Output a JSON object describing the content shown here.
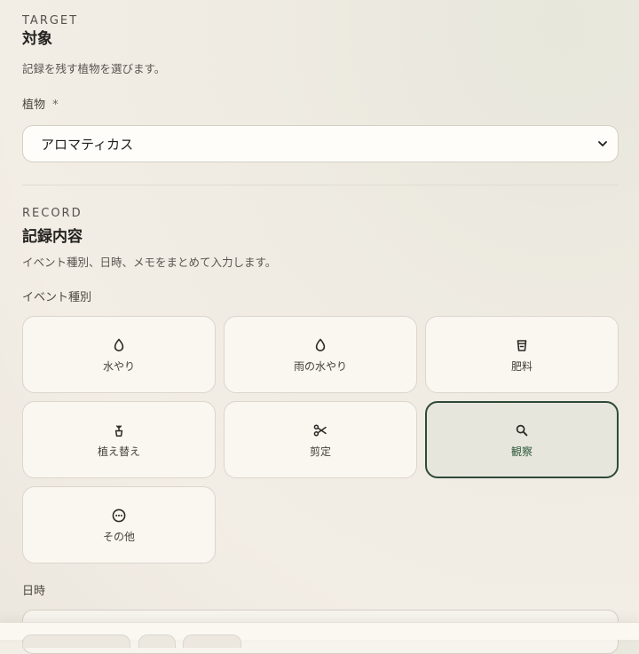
{
  "target_section": {
    "eyebrow": "TARGET",
    "title": "対象",
    "description": "記録を残す植物を選びます。",
    "plant_label": "植物",
    "required_mark": "*",
    "plant_selected": "アロマティカス"
  },
  "record_section": {
    "eyebrow": "RECORD",
    "title": "記録内容",
    "description": "イベント種別、日時、メモをまとめて入力します。",
    "event_type_label": "イベント種別",
    "event_types": [
      {
        "label": "水やり",
        "icon": "water-drop-icon",
        "selected": false
      },
      {
        "label": "雨の水やり",
        "icon": "water-drop-icon",
        "selected": false
      },
      {
        "label": "肥料",
        "icon": "fertilizer-bag-icon",
        "selected": false
      },
      {
        "label": "植え替え",
        "icon": "potted-plant-icon",
        "selected": false
      },
      {
        "label": "剪定",
        "icon": "scissors-icon",
        "selected": false
      },
      {
        "label": "観察",
        "icon": "search-icon",
        "selected": true
      },
      {
        "label": "その他",
        "icon": "more-circle-icon",
        "selected": false
      }
    ],
    "datetime_label": "日時"
  },
  "colors": {
    "accent": "#2e4a38",
    "accent_text": "#2d5a3d",
    "tile_bg": "#faf6f0",
    "selected_bg": "#e7e6dd"
  }
}
